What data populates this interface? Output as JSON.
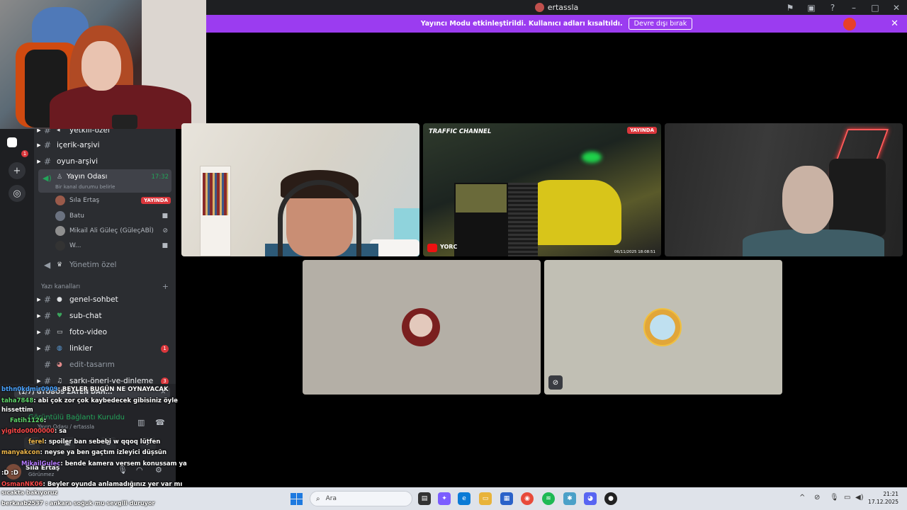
{
  "window": {
    "title": "ertassla",
    "banner_text": "Yayıncı Modu etkinleştirildi. Kullanıcı adları kısaltıldı.",
    "banner_button": "Devre dışı bırak"
  },
  "sidebar": {
    "channels_top": [
      {
        "name": "yetkili-özel",
        "icon": "megaphone-icon"
      },
      {
        "name": "içerik-arşivi",
        "icon": ""
      },
      {
        "name": "oyun-arşivi",
        "icon": ""
      }
    ],
    "voice_channel": {
      "name": "Yayın Odası",
      "time": "17:32",
      "status": "Bir kanal durumu belirle"
    },
    "members": [
      {
        "name": "Sıla Ertaş",
        "tag": "YAYINDA"
      },
      {
        "name": "Batu",
        "tag": ""
      },
      {
        "name": "Mikail Ali Güleç (GüleçABİ)",
        "tag": ""
      },
      {
        "name": "W...",
        "tag": ""
      }
    ],
    "admin_channel": "Yönetim özel",
    "text_section": "Yazı kanalları",
    "text_channels": [
      {
        "name": "genel-sohbet",
        "badge": ""
      },
      {
        "name": "sub-chat",
        "badge": ""
      },
      {
        "name": "foto-video",
        "badge": ""
      },
      {
        "name": "linkler",
        "badge": "1"
      },
      {
        "name": "edit-tasarım",
        "badge": ""
      },
      {
        "name": "şarkı-öneri-ve-dinleme",
        "badge": "3"
      }
    ]
  },
  "voice_panel": {
    "popup": "(1/7) GTOBOS ZATEN DAH...",
    "status": "Görüntülü Bağlantı Kuruldu",
    "sub": "Yayın Odası / ertassla",
    "user": "Sıla Ertaş",
    "user_state": "Görünmez"
  },
  "chat": [
    {
      "user": "bthn0kdmir0909",
      "text": ": BEYLER BUGÜN NE OYNAYACAK"
    },
    {
      "user": "taha7848",
      "text": ": abi çok zor çok kaybedecek gibisiniz öyle"
    },
    {
      "user": "",
      "text": "hissettim"
    },
    {
      "user": "Fatih1126",
      "text": ":"
    },
    {
      "user": "yigitdo0000000",
      "text": ": sa"
    },
    {
      "user": "ferel",
      "text": ": spoiler ban sebebi w qqoq lütfen"
    },
    {
      "user": "manyakcon",
      "text": ": neyse ya ben gaçtım izleyici düşsün"
    },
    {
      "user": "MikailGulec",
      "text": ": bende kamera versem konussam ya"
    },
    {
      "user": "",
      "text": ":D :D"
    },
    {
      "user": "OsmanNK06",
      "text": ": Beyler oyunda anlamadığınız yer var mı"
    }
  ],
  "taskbar": {
    "left_line1": "sıcakta bakıyoruz",
    "left_line2": "berkaab2537 : ankara soğuk mu sevgili duruyor",
    "search_placeholder": "Ara",
    "time": "21:21",
    "date": "17.12.2025"
  },
  "tiles": {
    "traffic_label": "TRAFFIC CHANNEL",
    "live_tag": "YAYINDA",
    "yt_text": "YORC",
    "timestamp": "06/11/2025  18:08:51"
  }
}
